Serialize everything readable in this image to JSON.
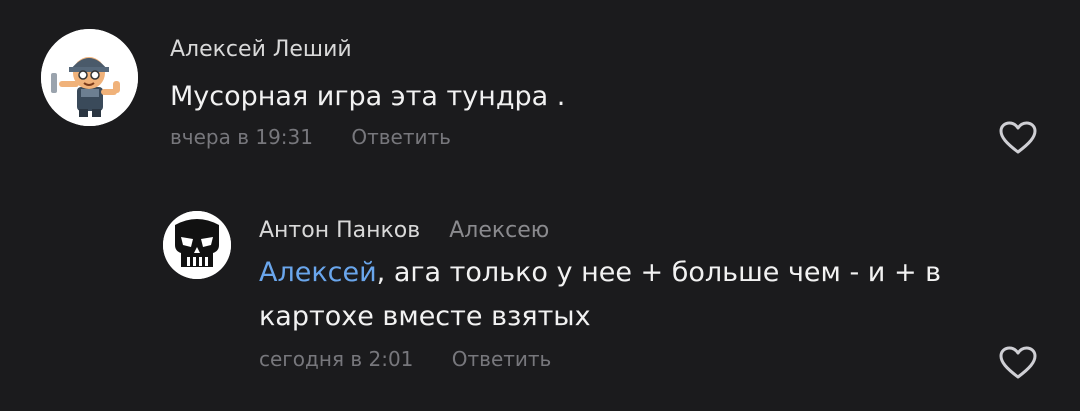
{
  "comments": [
    {
      "author": "Алексей Леший",
      "text": "Мусорная игра эта тундра .",
      "timestamp": "вчера в 19:31",
      "reply_label": "Ответить",
      "like_icon": "heart-outline-icon",
      "avatar_icon": "cartoon-mechanic-avatar"
    },
    {
      "author": "Антон Панков",
      "reply_to": "Алексею",
      "mention": "Алексей",
      "text_line1_rest": ", ага только у нее + больше чем - и + в",
      "text_line2": "картохе вместе взятых",
      "timestamp": "сегодня в 2:01",
      "reply_label": "Ответить",
      "like_icon": "heart-outline-icon",
      "avatar_icon": "punisher-skull-avatar"
    }
  ],
  "colors": {
    "background": "#1b1b1d",
    "mention": "#6aa6ec",
    "muted": "#77777c"
  }
}
